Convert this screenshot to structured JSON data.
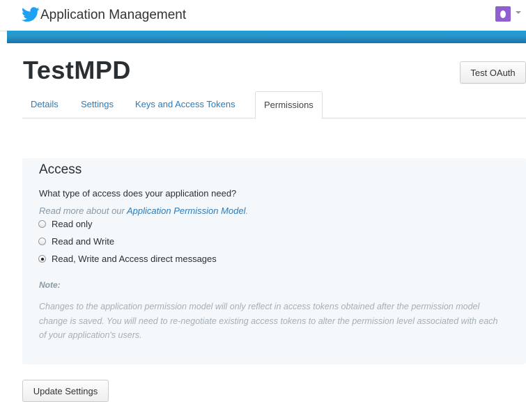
{
  "header": {
    "app_title": "Application Management",
    "logo_icon": "twitter-bird-icon",
    "avatar_icon": "user-avatar-icon",
    "accent_color": "#1da1f2",
    "bar_color": "#2c93c8"
  },
  "app": {
    "name": "TestMPD",
    "test_oauth_label": "Test OAuth"
  },
  "tabs": [
    {
      "label": "Details",
      "active": false
    },
    {
      "label": "Settings",
      "active": false
    },
    {
      "label": "Keys and Access Tokens",
      "active": false
    },
    {
      "label": "Permissions",
      "active": true
    }
  ],
  "access": {
    "title": "Access",
    "question": "What type of access does your application need?",
    "read_more_prefix": "Read more about our ",
    "read_more_link": "Application Permission Model",
    "read_more_suffix": ".",
    "options": [
      {
        "label": "Read only",
        "checked": false
      },
      {
        "label": "Read and Write",
        "checked": false
      },
      {
        "label": "Read, Write and Access direct messages",
        "checked": true
      }
    ],
    "note_label": "Note:",
    "note_text": "Changes to the application permission model will only reflect in access tokens obtained after the permission model change is saved. You will need to re-negotiate existing access tokens to alter the permission level associated with each of your application's users."
  },
  "footer": {
    "update_label": "Update Settings"
  }
}
